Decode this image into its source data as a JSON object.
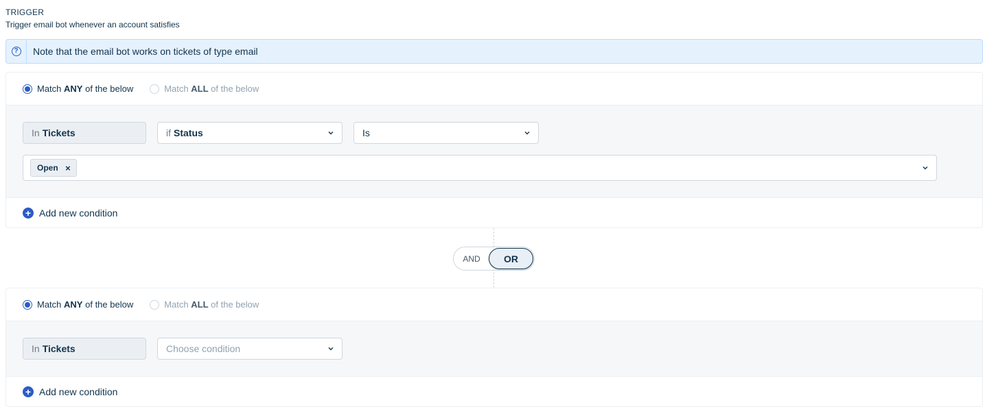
{
  "header": {
    "title": "TRIGGER",
    "subtitle": "Trigger email bot whenever an account satisfies"
  },
  "note": {
    "icon": "question-circle-icon",
    "text": "Note that the email bot works on tickets of type email"
  },
  "groups": [
    {
      "match_any": {
        "prefix": "Match",
        "keyword": "ANY",
        "suffix": "of the below",
        "selected": true
      },
      "match_all": {
        "prefix": "Match",
        "keyword": "ALL",
        "suffix": "of the below",
        "selected": false
      },
      "module": {
        "prefix": "In",
        "value": "Tickets"
      },
      "condition": {
        "prefix": "if",
        "value": "Status"
      },
      "operator": {
        "value": "Is"
      },
      "values": [
        {
          "label": "Open"
        }
      ],
      "add_label": "Add new condition"
    },
    {
      "match_any": {
        "prefix": "Match",
        "keyword": "ANY",
        "suffix": "of the below",
        "selected": true
      },
      "match_all": {
        "prefix": "Match",
        "keyword": "ALL",
        "suffix": "of the below",
        "selected": false
      },
      "module": {
        "prefix": "In",
        "value": "Tickets"
      },
      "condition": {
        "placeholder": "Choose condition"
      },
      "add_label": "Add new condition"
    }
  ],
  "logic_toggle": {
    "and_label": "AND",
    "or_label": "OR",
    "selected": "OR"
  },
  "colors": {
    "accent": "#2c5cc5",
    "note_bg": "#e5f2fd",
    "text": "#12344d"
  }
}
